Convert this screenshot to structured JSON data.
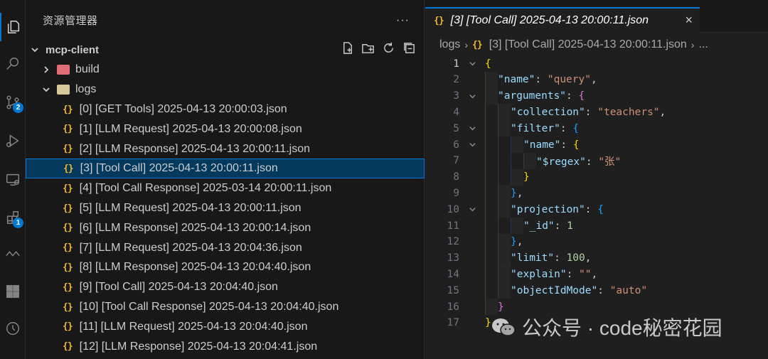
{
  "activity_bar": [
    {
      "icon": "explorer-icon",
      "active": true
    },
    {
      "icon": "search-icon"
    },
    {
      "icon": "source-control-icon",
      "badge": "2"
    },
    {
      "icon": "run-debug-icon"
    },
    {
      "icon": "remote-explorer-icon"
    },
    {
      "icon": "extensions-icon",
      "badge": "1"
    },
    {
      "icon": "gitlens-icon"
    },
    {
      "icon": "grid-icon"
    },
    {
      "icon": "timeline-icon"
    }
  ],
  "sidebar": {
    "title": "资源管理器",
    "more": "···",
    "root": "mcp-client",
    "folders": [
      {
        "name": "build",
        "expanded": false
      },
      {
        "name": "logs",
        "expanded": true
      }
    ],
    "files": [
      "[0] [GET Tools] 2025-04-13 20:00:03.json",
      "[1] [LLM Request] 2025-04-13 20:00:08.json",
      "[2] [LLM Response] 2025-04-13 20:00:11.json",
      "[3] [Tool Call] 2025-04-13 20:00:11.json",
      "[4] [Tool Call Response] 2025-03-14 20:00:11.json",
      "[5] [LLM Request] 2025-04-13 20:00:11.json",
      "[6] [LLM Response] 2025-04-13 20:00:14.json",
      "[7] [LLM Request] 2025-04-13 20:04:36.json",
      "[8] [LLM Response] 2025-04-13 20:04:40.json",
      "[9] [Tool Call] 2025-04-13 20:04:40.json",
      "[10] [Tool Call Response] 2025-04-13 20:04:40.json",
      "[11] [LLM Request] 2025-04-13 20:04:40.json",
      "[12] [LLM Response] 2025-04-13 20:04:41.json"
    ],
    "selected_index": 3
  },
  "editor": {
    "tab_label": "[3] [Tool Call] 2025-04-13 20:00:11.json",
    "tab_close": "×",
    "breadcrumb": {
      "folder": "logs",
      "file": "[3] [Tool Call] 2025-04-13 20:00:11.json",
      "more": "..."
    },
    "lines": [
      {
        "n": "1",
        "fold": true,
        "depth": 0,
        "code": [
          [
            "b1",
            "{"
          ]
        ]
      },
      {
        "n": "2",
        "depth": 1,
        "code": [
          [
            "k",
            "\"name\""
          ],
          [
            "p",
            ": "
          ],
          [
            "s",
            "\"query\""
          ],
          [
            "p",
            ","
          ]
        ]
      },
      {
        "n": "3",
        "fold": true,
        "depth": 1,
        "code": [
          [
            "k",
            "\"arguments\""
          ],
          [
            "p",
            ": "
          ],
          [
            "b2",
            "{"
          ]
        ]
      },
      {
        "n": "4",
        "depth": 2,
        "code": [
          [
            "k",
            "\"collection\""
          ],
          [
            "p",
            ": "
          ],
          [
            "s",
            "\"teachers\""
          ],
          [
            "p",
            ","
          ]
        ]
      },
      {
        "n": "5",
        "fold": true,
        "depth": 2,
        "code": [
          [
            "k",
            "\"filter\""
          ],
          [
            "p",
            ": "
          ],
          [
            "b3",
            "{"
          ]
        ]
      },
      {
        "n": "6",
        "fold": true,
        "depth": 3,
        "code": [
          [
            "k",
            "\"name\""
          ],
          [
            "p",
            ": "
          ],
          [
            "b1",
            "{"
          ]
        ]
      },
      {
        "n": "7",
        "depth": 4,
        "code": [
          [
            "k",
            "\"$regex\""
          ],
          [
            "p",
            ": "
          ],
          [
            "s",
            "\"张\""
          ]
        ]
      },
      {
        "n": "8",
        "depth": 3,
        "code": [
          [
            "b1",
            "}"
          ]
        ]
      },
      {
        "n": "9",
        "depth": 2,
        "code": [
          [
            "b3",
            "}"
          ],
          [
            "p",
            ","
          ]
        ]
      },
      {
        "n": "10",
        "fold": true,
        "depth": 2,
        "code": [
          [
            "k",
            "\"projection\""
          ],
          [
            "p",
            ": "
          ],
          [
            "b3",
            "{"
          ]
        ]
      },
      {
        "n": "11",
        "depth": 3,
        "code": [
          [
            "k",
            "\"_id\""
          ],
          [
            "p",
            ": "
          ],
          [
            "n",
            "1"
          ]
        ]
      },
      {
        "n": "12",
        "depth": 2,
        "code": [
          [
            "b3",
            "}"
          ],
          [
            "p",
            ","
          ]
        ]
      },
      {
        "n": "13",
        "depth": 2,
        "code": [
          [
            "k",
            "\"limit\""
          ],
          [
            "p",
            ": "
          ],
          [
            "n",
            "100"
          ],
          [
            "p",
            ","
          ]
        ]
      },
      {
        "n": "14",
        "depth": 2,
        "code": [
          [
            "k",
            "\"explain\""
          ],
          [
            "p",
            ": "
          ],
          [
            "s",
            "\"\""
          ],
          [
            "p",
            ","
          ]
        ]
      },
      {
        "n": "15",
        "depth": 2,
        "code": [
          [
            "k",
            "\"objectIdMode\""
          ],
          [
            "p",
            ": "
          ],
          [
            "s",
            "\"auto\""
          ]
        ]
      },
      {
        "n": "16",
        "depth": 1,
        "code": [
          [
            "b2",
            "}"
          ]
        ]
      },
      {
        "n": "17",
        "depth": 0,
        "code": [
          [
            "b1",
            "}"
          ]
        ]
      }
    ]
  },
  "watermark": "公众号 · code秘密花园"
}
